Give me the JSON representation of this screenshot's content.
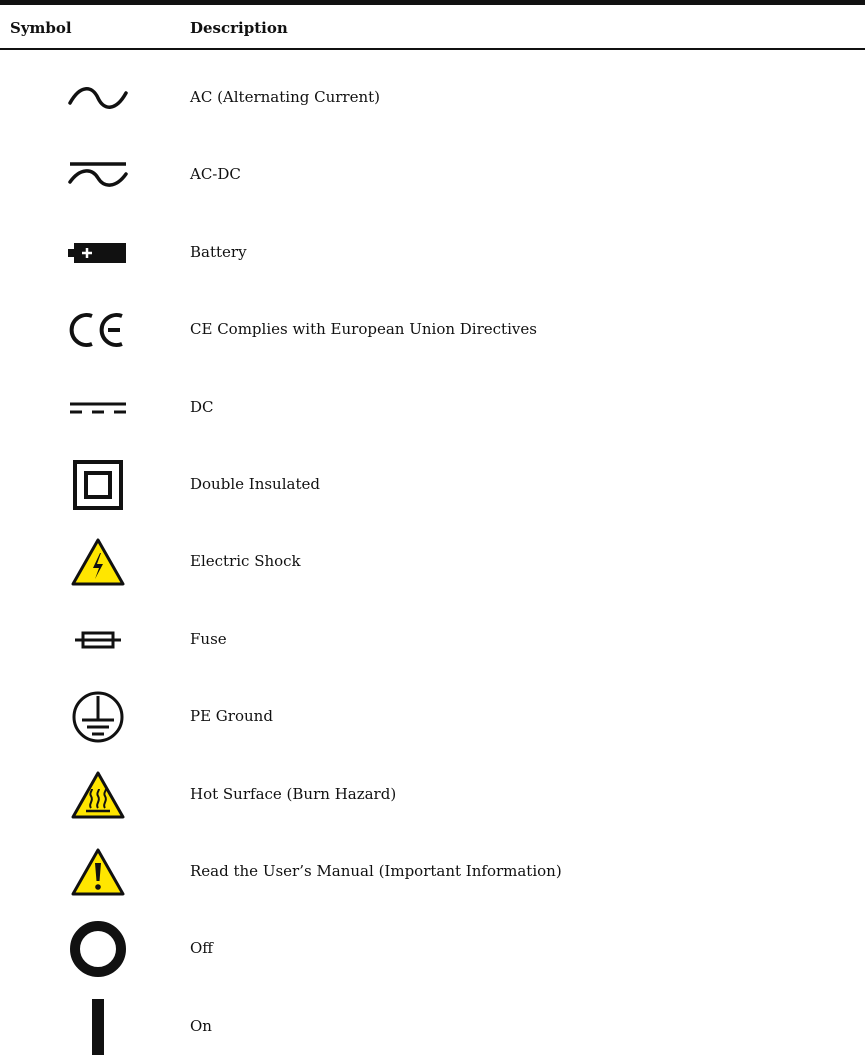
{
  "header": {
    "symbol_label": "Symbol",
    "description_label": "Description"
  },
  "rows": [
    {
      "icon": "ac-icon",
      "label": "AC (Alternating Current)"
    },
    {
      "icon": "ac-dc-icon",
      "label": "AC-DC"
    },
    {
      "icon": "battery-icon",
      "label": "Battery"
    },
    {
      "icon": "ce-mark-icon",
      "label": "CE Complies with European Union Directives"
    },
    {
      "icon": "dc-icon",
      "label": "DC"
    },
    {
      "icon": "double-insulated-icon",
      "label": "Double Insulated"
    },
    {
      "icon": "electric-shock-icon",
      "label": "Electric Shock"
    },
    {
      "icon": "fuse-icon",
      "label": "Fuse"
    },
    {
      "icon": "pe-ground-icon",
      "label": "PE Ground"
    },
    {
      "icon": "hot-surface-icon",
      "label": "Hot Surface (Burn Hazard)"
    },
    {
      "icon": "warning-icon",
      "label": "Read the User’s Manual (Important Information)"
    },
    {
      "icon": "off-icon",
      "label": "Off"
    },
    {
      "icon": "on-icon",
      "label": "On"
    }
  ],
  "colors": {
    "ink": "#111111",
    "warning_yellow": "#ffe600"
  }
}
